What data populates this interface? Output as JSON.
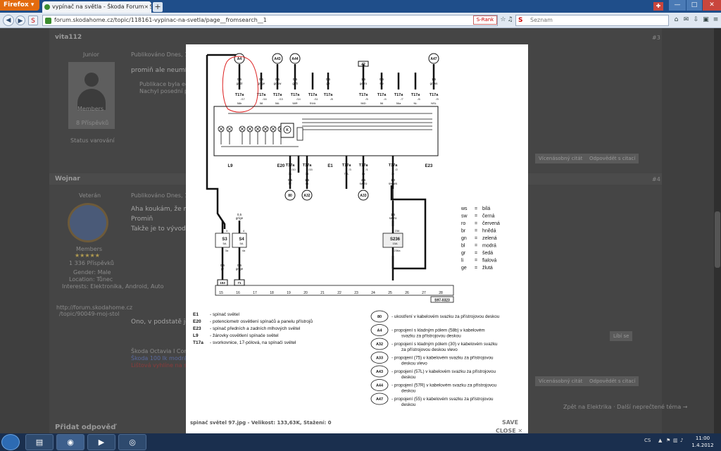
{
  "browser": {
    "menu_label": "Firefox",
    "tab_title": "vypínač na světla - Škoda Forum - SKOD...",
    "tab_close": "×",
    "new_tab": "+",
    "url": "forum.skodahome.cz/topic/118161-vypinac-na-svetla/page__fromsearch__1",
    "star": "☆",
    "srank": "S-Rank",
    "search_placeholder": "Seznam",
    "search_icon": "S",
    "win_min": "—",
    "win_max": "□",
    "win_close": "✕"
  },
  "forum": {
    "posts": [
      {
        "author": "vita112",
        "role": "Junior",
        "group": "Members",
        "posts_count": "8 Příspěvků",
        "status": "Status varování",
        "date": "Publikováno Dnes, 10:",
        "text": "promiň ale neumím s",
        "notice_line1": "Publikace byla edit",
        "notice_line2": "Nachyl posední př",
        "number": "#3",
        "btn_quote_multi": "Vícenásobný citát",
        "btn_quote": "Odpovědět s citací"
      },
      {
        "author": "Wojnar",
        "role": "Veterán",
        "group": "Members",
        "rating": "★★★★★",
        "posts_count": "1 336 Příspěvků",
        "gender": "Gender: Male",
        "location": "Location: Tůnec",
        "interests": "Interests: Elektronika, Android, Auto",
        "sig_link1": "http://forum.skodahome.cz",
        "sig_link2": "/topic/90049-moj-stol",
        "date": "Publikováno Dnes, 10:4",
        "text_line1": "Aha koukám, že máš",
        "text_line2": "Promiň",
        "text_line3": "Takže je to vývod pro",
        "text_line4": "Ono, v podstatě je pro",
        "number": "#4",
        "sig_text1": "Škoda Octavia I Combi",
        "sig_text2": "Škoda 100 lk modrá",
        "sig_text3": "Lištová vyhlíne na sk",
        "btn_quote_multi": "Vícenásobný citát",
        "btn_quote": "Odpovědět s citací",
        "btn_like": "Líbí se"
      }
    ],
    "breadcrumb": "Zpět na Elektrika · Další neprečtené téma →",
    "reply_heading": "Přidat odpověď"
  },
  "lightbox": {
    "caption": "spinač světel 97.jpg - Velikost: 133,63K, Stažení: 0",
    "save": "SAVE",
    "close": "CLOSE ✕"
  },
  "diagram": {
    "connectors_top": [
      {
        "id": "A4",
        "wire": "0,5",
        "color": "gr/bl",
        "term": "T17a",
        "pin": "/17",
        "sig": "58b"
      },
      {
        "id": "",
        "wire": "0,5",
        "color": "gr/ge",
        "term": "T17a",
        "pin": "/16",
        "sig": "58"
      },
      {
        "id": "A43",
        "wire": "0,5",
        "color": "gr/sw",
        "term": "T17a",
        "pin": "/13",
        "sig": "56L"
      },
      {
        "id": "A44",
        "wire": "0,5",
        "color": "gr/li",
        "term": "T17a",
        "pin": "/14",
        "sig": "58R"
      },
      {
        "id": "",
        "wire": "",
        "color": "",
        "term": "T17a",
        "pin": "/11",
        "sig": "S9/A"
      },
      {
        "id": "",
        "wire": "0,5",
        "color": "ge",
        "term": "T17a",
        "pin": "/8",
        "sig": ""
      },
      {
        "id": "42",
        "wire": "1,5",
        "color": "ge/ro",
        "term": "T17a",
        "pin": "/5",
        "sig": "56D"
      },
      {
        "id": "",
        "wire": "0,5",
        "color": "sw",
        "term": "T17a",
        "pin": "/4",
        "sig": "56"
      },
      {
        "id": "",
        "wire": "",
        "color": "",
        "term": "T17a",
        "pin": "/7",
        "sig": "56a"
      },
      {
        "id": "",
        "wire": "",
        "color": "",
        "term": "T17a",
        "pin": "/6",
        "sig": "NL"
      },
      {
        "id": "A47",
        "wire": "1,5",
        "color": "gr/ws",
        "term": "T17a",
        "pin": "/9",
        "sig": "NSL"
      }
    ],
    "comp_labels": {
      "L9": "L9",
      "E20": "E20",
      "E1": "E1",
      "E23": "E23",
      "K": "K"
    },
    "connectors_mid": [
      {
        "term": "T17a",
        "pin": "/10",
        "sig": "31",
        "wire": "0,5",
        "color": "br",
        "ref": "80"
      },
      {
        "term": "T17a",
        "pin": "/15",
        "sig": "30",
        "wire": "1,5",
        "color": "ro",
        "ref": "A32"
      },
      {
        "term": "T17a",
        "pin": "/3",
        "sig": "TFL",
        "wire": "",
        "color": "",
        "ref": ""
      },
      {
        "term": "T17a",
        "pin": "/1",
        "sig": "Xz",
        "wire": "2,5",
        "color": "sw/ro",
        "ref": "A33"
      },
      {
        "term": "T17a",
        "pin": "/2",
        "sig": "Xr",
        "wire": "1,0",
        "color": "sw/ws",
        "ref": ""
      }
    ],
    "fuses": [
      {
        "name": "S3",
        "amp": "5A",
        "top": "3",
        "bot": "3a",
        "wire_top": "",
        "color_top": "",
        "wire": "0,5",
        "color": "gr",
        "ref": "153"
      },
      {
        "name": "S4",
        "amp": "5A",
        "top": "4",
        "bot": "4a",
        "wire_top": "0,5",
        "color_top": "gr/ge",
        "wire": "0,5",
        "color": "gr/ge",
        "ref": "71"
      },
      {
        "name": "S236",
        "amp": "15A",
        "top": "236",
        "bot": "236a",
        "wire_top": "1,5",
        "color_top": "sw/ro",
        "wire": "",
        "color": "",
        "ref": ""
      }
    ],
    "scale": [
      "15",
      "16",
      "17",
      "18",
      "19",
      "20",
      "21",
      "22",
      "23",
      "24",
      "25",
      "26",
      "27",
      "28"
    ],
    "code": "S97-0323",
    "color_legend": [
      {
        "abbr": "ws",
        "eq": "=",
        "name": "bílá"
      },
      {
        "abbr": "sw",
        "eq": "=",
        "name": "černá"
      },
      {
        "abbr": "ro",
        "eq": "=",
        "name": "červená"
      },
      {
        "abbr": "br",
        "eq": "=",
        "name": "hnědá"
      },
      {
        "abbr": "gn",
        "eq": "=",
        "name": "zelená"
      },
      {
        "abbr": "bl",
        "eq": "=",
        "name": "modrá"
      },
      {
        "abbr": "gr",
        "eq": "=",
        "name": "šedá"
      },
      {
        "abbr": "li",
        "eq": "=",
        "name": "fialová"
      },
      {
        "abbr": "ge",
        "eq": "=",
        "name": "žlutá"
      }
    ],
    "components": [
      {
        "code": "E1",
        "desc": "-   spínač světel"
      },
      {
        "code": "E20",
        "desc": "-   potenciometr osvětlení spínačů a panelu přístrojů"
      },
      {
        "code": "E23",
        "desc": "-   spínač předních a zadních mlhových světel"
      },
      {
        "code": "L9",
        "desc": "-   žárovky osvětlení spínače světel"
      },
      {
        "code": "T17a",
        "desc": "-   svorkovnice, 17-pólová, na spínači světel"
      }
    ],
    "refs": [
      {
        "code": "80",
        "l1": "-  ukostření v kabelovém svazku za přístrojovou deskou",
        "l2": ""
      },
      {
        "code": "A4",
        "l1": "-  propojení s kladným pólem (58b) v kabelovém",
        "l2": "svazku za přístrojovou deskou"
      },
      {
        "code": "A32",
        "l1": "-  propojení s kladným pólem (30) v kabelovém svazku",
        "l2": "za přístrojovou deskou vlevo"
      },
      {
        "code": "A33",
        "l1": "-  propojení (75) v kabelovém svazku za přístrojovou",
        "l2": "deskou vlevo"
      },
      {
        "code": "A43",
        "l1": "-  propojení (57L) v kabelovém svazku za přístrojovou",
        "l2": "deskou"
      },
      {
        "code": "A44",
        "l1": "-  propojení (57R) v kabelovém svazku za přístrojovou",
        "l2": "deskou"
      },
      {
        "code": "A47",
        "l1": "-  propojení (55) v kabelovém svazku za přístrojovou",
        "l2": "deskou"
      }
    ]
  },
  "taskbar": {
    "lang": "CS",
    "time": "11:00",
    "date": "1.4.2012"
  }
}
